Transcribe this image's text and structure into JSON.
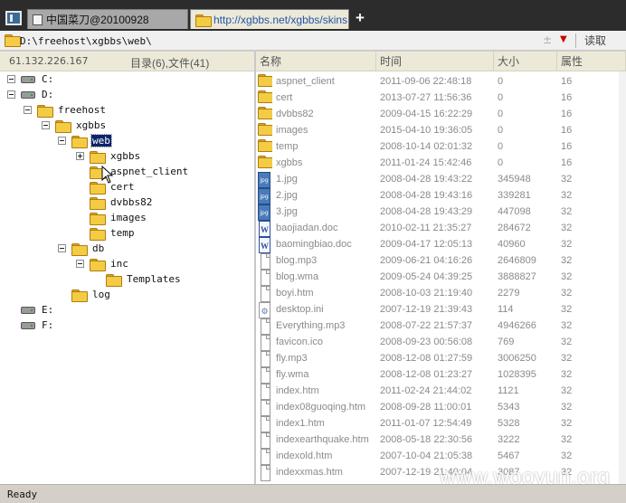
{
  "tabs": [
    {
      "label": "中国菜刀@20100928",
      "active": false
    },
    {
      "label": "http://xgbbs.net/xgbbs/skins...",
      "active": true
    }
  ],
  "new_tab_label": "+",
  "address": {
    "value": "D:\\freehost\\xgbbs\\web\\",
    "plus": "±",
    "read_label": "读取"
  },
  "left": {
    "server_ip": "61.132.226.167",
    "dir_count": "目录(6),文件(41)",
    "tree": [
      {
        "label": "C:",
        "toggle": "minus",
        "icon": "drive-icon"
      },
      {
        "label": "D:",
        "toggle": "minus",
        "icon": "drive-icon"
      },
      {
        "label": "freehost",
        "toggle": "minus",
        "icon": "folder-icon"
      },
      {
        "label": "xgbbs",
        "toggle": "minus",
        "icon": "folder-icon"
      },
      {
        "label": "web",
        "toggle": "minus",
        "icon": "folder-open-icon",
        "selected": true
      },
      {
        "label": "xgbbs",
        "toggle": "plus",
        "icon": "folder-icon"
      },
      {
        "label": "aspnet_client",
        "toggle": "none",
        "icon": "folder-icon"
      },
      {
        "label": "cert",
        "toggle": "none",
        "icon": "folder-icon"
      },
      {
        "label": "dvbbs82",
        "toggle": "none",
        "icon": "folder-icon"
      },
      {
        "label": "images",
        "toggle": "none",
        "icon": "folder-icon"
      },
      {
        "label": "temp",
        "toggle": "none",
        "icon": "folder-icon"
      },
      {
        "label": "db",
        "toggle": "minus",
        "icon": "folder-icon"
      },
      {
        "label": "inc",
        "toggle": "minus",
        "icon": "folder-icon"
      },
      {
        "label": "Templates",
        "toggle": "none",
        "icon": "folder-icon"
      },
      {
        "label": "log",
        "toggle": "none",
        "icon": "folder-icon"
      },
      {
        "label": "E:",
        "toggle": "none",
        "icon": "drive-icon"
      },
      {
        "label": "F:",
        "toggle": "none",
        "icon": "drive-icon"
      }
    ]
  },
  "list": {
    "columns": [
      "名称",
      "时间",
      "大小",
      "属性"
    ],
    "rows": [
      {
        "icon": "folder",
        "name": "aspnet_client",
        "time": "2011-09-06 22:48:18",
        "size": "0",
        "attr": "16"
      },
      {
        "icon": "folder",
        "name": "cert",
        "time": "2013-07-27 11:56:36",
        "size": "0",
        "attr": "16"
      },
      {
        "icon": "folder",
        "name": "dvbbs82",
        "time": "2009-04-15 16:22:29",
        "size": "0",
        "attr": "16"
      },
      {
        "icon": "folder",
        "name": "images",
        "time": "2015-04-10 19:36:05",
        "size": "0",
        "attr": "16"
      },
      {
        "icon": "folder",
        "name": "temp",
        "time": "2008-10-14 02:01:32",
        "size": "0",
        "attr": "16"
      },
      {
        "icon": "folder",
        "name": "xgbbs",
        "time": "2011-01-24 15:42:46",
        "size": "0",
        "attr": "16"
      },
      {
        "icon": "jpg",
        "name": "1.jpg",
        "time": "2008-04-28 19:43:22",
        "size": "345948",
        "attr": "32"
      },
      {
        "icon": "jpg",
        "name": "2.jpg",
        "time": "2008-04-28 19:43:16",
        "size": "339281",
        "attr": "32"
      },
      {
        "icon": "jpg",
        "name": "3.jpg",
        "time": "2008-04-28 19:43:29",
        "size": "447098",
        "attr": "32"
      },
      {
        "icon": "doc",
        "name": "baojiadan.doc",
        "time": "2010-02-11 21:35:27",
        "size": "284672",
        "attr": "32"
      },
      {
        "icon": "doc",
        "name": "baomingbiao.doc",
        "time": "2009-04-17 12:05:13",
        "size": "40960",
        "attr": "32"
      },
      {
        "icon": "file",
        "name": "blog.mp3",
        "time": "2009-06-21 04:16:26",
        "size": "2646809",
        "attr": "32"
      },
      {
        "icon": "file",
        "name": "blog.wma",
        "time": "2009-05-24 04:39:25",
        "size": "3888827",
        "attr": "32"
      },
      {
        "icon": "file",
        "name": "boyi.htm",
        "time": "2008-10-03 21:19:40",
        "size": "2279",
        "attr": "32"
      },
      {
        "icon": "ini",
        "name": "desktop.ini",
        "time": "2007-12-19 21:39:43",
        "size": "114",
        "attr": "32"
      },
      {
        "icon": "file",
        "name": "Everything.mp3",
        "time": "2008-07-22 21:57:37",
        "size": "4946266",
        "attr": "32"
      },
      {
        "icon": "file",
        "name": "favicon.ico",
        "time": "2008-09-23 00:56:08",
        "size": "769",
        "attr": "32"
      },
      {
        "icon": "file",
        "name": "fly.mp3",
        "time": "2008-12-08 01:27:59",
        "size": "3006250",
        "attr": "32"
      },
      {
        "icon": "file",
        "name": "fly.wma",
        "time": "2008-12-08 01:23:27",
        "size": "1028395",
        "attr": "32"
      },
      {
        "icon": "file",
        "name": "index.htm",
        "time": "2011-02-24 21:44:02",
        "size": "1121",
        "attr": "32"
      },
      {
        "icon": "file",
        "name": "index08guoqing.htm",
        "time": "2008-09-28 11:00:01",
        "size": "5343",
        "attr": "32"
      },
      {
        "icon": "file",
        "name": "index1.htm",
        "time": "2011-01-07 12:54:49",
        "size": "5328",
        "attr": "32"
      },
      {
        "icon": "file",
        "name": "indexearthquake.htm",
        "time": "2008-05-18 22:30:56",
        "size": "3222",
        "attr": "32"
      },
      {
        "icon": "file",
        "name": "indexold.htm",
        "time": "2007-10-04 21:05:38",
        "size": "5467",
        "attr": "32"
      },
      {
        "icon": "file",
        "name": "indexxmas.htm",
        "time": "2007-12-19 21:40:04",
        "size": "3087",
        "attr": "32"
      }
    ]
  },
  "status": "Ready",
  "watermark": "www.wooyun.org"
}
